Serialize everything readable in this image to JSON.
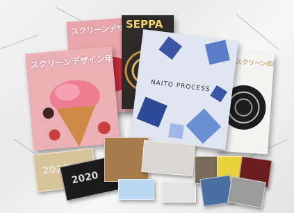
{
  "photo": {
    "subject": "Printed magazines and collectible cards on a marble surface"
  },
  "magazines": {
    "icecream_front": {
      "title": "スクリーンデザイン年鑑"
    },
    "icecream_back": {
      "title": "スクリーンデザイン年鑑"
    },
    "seppa": {
      "title": "SEPPA"
    },
    "naito": {
      "title": "NAITO PROCESS"
    },
    "white_back": {
      "title": "スクリーン印刷"
    }
  },
  "cards": {
    "year_text": "2020"
  },
  "colors": {
    "pink_cover": "#e9a7ae",
    "blue_cover": "#dfe6f2",
    "seppa_cover": "#2f2a2a",
    "marble": "#efefef"
  }
}
